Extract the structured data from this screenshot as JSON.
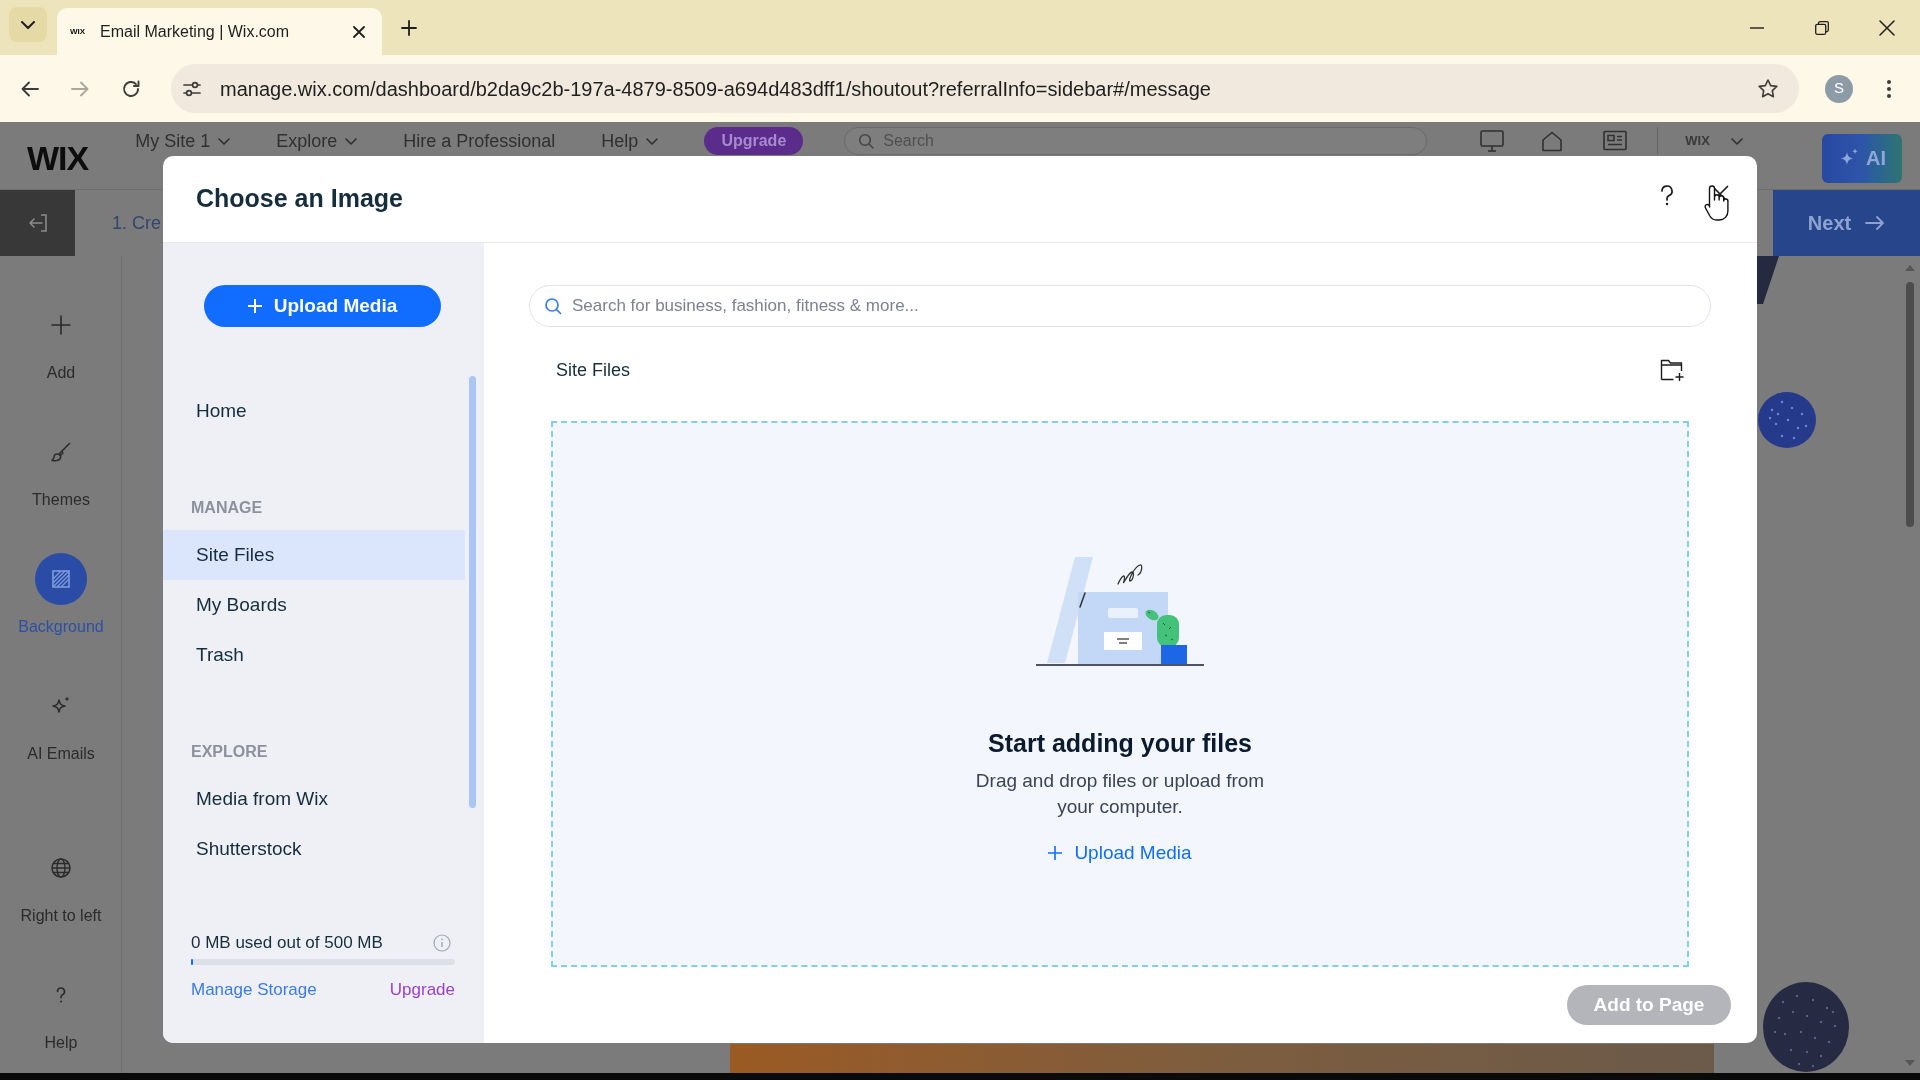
{
  "browser": {
    "tabs": [
      {
        "favicon": "WIX",
        "title": "Email Marketing | Wix.com",
        "selected": true
      }
    ],
    "address_bar": {
      "url": "manage.wix.com/dashboard/b2da9c2b-197a-4879-8509-a694d483dff1/shoutout?referralInfo=sidebar#/message"
    },
    "profile": {
      "initial": "S"
    }
  },
  "editor": {
    "logo": "WIX",
    "menu": [
      {
        "label": "My Site 1",
        "dropdown": true
      },
      {
        "label": "Explore",
        "dropdown": true
      },
      {
        "label": "Hire a Professional",
        "dropdown": false
      },
      {
        "label": "Help",
        "dropdown": true
      }
    ],
    "upgrade_button": "Upgrade",
    "search": {
      "placeholder": "Search"
    },
    "account_logo": "WIX",
    "ai_button": "AI",
    "step_title": "1. Cre",
    "next_button": "Next",
    "sidebar": [
      {
        "label": "Add",
        "selected": false
      },
      {
        "label": "Themes",
        "selected": false
      },
      {
        "label": "Background",
        "selected": true
      },
      {
        "label": "AI Emails",
        "selected": false
      },
      {
        "label": "Right to left",
        "selected": false
      },
      {
        "label": "Help",
        "selected": false
      }
    ]
  },
  "dialog": {
    "title": "Choose an Image",
    "upload_button": "Upload Media",
    "nav": {
      "items": [
        {
          "label": "Home",
          "selected": false
        }
      ],
      "sections": [
        {
          "heading": "MANAGE",
          "items": [
            {
              "label": "Site Files",
              "selected": true
            },
            {
              "label": "My Boards",
              "selected": false
            },
            {
              "label": "Trash",
              "selected": false
            }
          ]
        },
        {
          "heading": "EXPLORE",
          "items": [
            {
              "label": "Media from Wix",
              "selected": false
            },
            {
              "label": "Shutterstock",
              "selected": false
            }
          ]
        }
      ]
    },
    "storage": {
      "usage": "0 MB used out of 500 MB",
      "level": 0,
      "manage_link": "Manage Storage",
      "upgrade_link": "Upgrade"
    },
    "search": {
      "placeholder": "Search for business, fashion, fitness & more..."
    },
    "folder_title": "Site Files",
    "empty_state": {
      "title": "Start adding your files",
      "description": "Drag and drop files or upload from your computer.",
      "upload_link": "Upload Media"
    },
    "add_button": {
      "label": "Add to Page",
      "disabled": true
    }
  }
}
